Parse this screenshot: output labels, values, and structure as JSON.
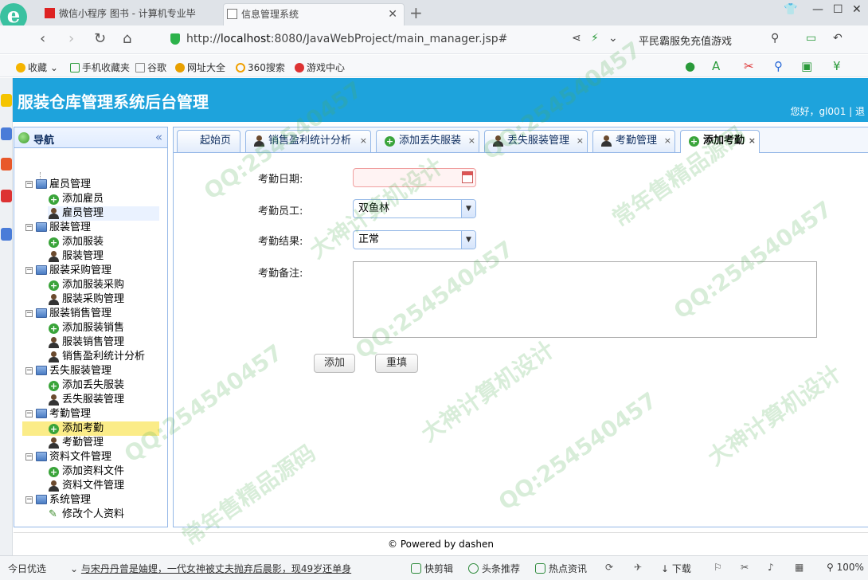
{
  "browser": {
    "tabs": [
      {
        "title": "微信小程序 图书 - 计算机专业毕"
      },
      {
        "title": "信息管理系统"
      }
    ],
    "new_tab": "+",
    "url_prefix": "http://",
    "url_host": "localhost",
    "url_path": ":8080/JavaWebProject/main_manager.jsp#",
    "search_hint": "平民霸服免充值游戏",
    "bookmarks": [
      "收藏",
      "手机收藏夹",
      "谷歌",
      "网址大全",
      "360搜索",
      "游戏中心"
    ]
  },
  "app": {
    "title": "服装仓库管理系统后台管理",
    "greeting": "您好，gl001 | 退"
  },
  "sidebar": {
    "title": "导航",
    "collapse": "«",
    "groups": [
      {
        "label": "雇员管理",
        "items": [
          "添加雇员",
          "雇员管理"
        ]
      },
      {
        "label": "服装管理",
        "items": [
          "添加服装",
          "服装管理"
        ]
      },
      {
        "label": "服装采购管理",
        "items": [
          "添加服装采购",
          "服装采购管理"
        ]
      },
      {
        "label": "服装销售管理",
        "items": [
          "添加服装销售",
          "服装销售管理",
          "销售盈利统计分析"
        ]
      },
      {
        "label": "丢失服装管理",
        "items": [
          "添加丢失服装",
          "丢失服装管理"
        ]
      },
      {
        "label": "考勤管理",
        "items": [
          "添加考勤",
          "考勤管理"
        ]
      },
      {
        "label": "资料文件管理",
        "items": [
          "添加资料文件",
          "资料文件管理"
        ]
      },
      {
        "label": "系统管理",
        "items": [
          "修改个人资料"
        ]
      }
    ]
  },
  "content": {
    "tabs": [
      "起始页",
      "销售盈利统计分析",
      "添加丢失服装",
      "丢失服装管理",
      "考勤管理",
      "添加考勤"
    ],
    "close": "×",
    "form": {
      "date_label": "考勤日期:",
      "date_value": "",
      "employee_label": "考勤员工:",
      "employee_value": "双鱼林",
      "result_label": "考勤结果:",
      "result_value": "正常",
      "note_label": "考勤备注:",
      "note_value": ""
    },
    "buttons": {
      "add": "添加",
      "reset": "重填"
    }
  },
  "footer": {
    "text": "© Powered by dashen"
  },
  "statusbar": {
    "left": "今日优选",
    "news": "与宋丹丹曾是妯娌，一代女神被丈夫抛弃后晨影，现49岁还单身",
    "items": [
      "快剪辑",
      "头条推荐",
      "热点资讯",
      "下载",
      "100%"
    ]
  },
  "watermarks": [
    "QQ:254540457",
    "大神计算机设计",
    "常年售精品源码"
  ]
}
